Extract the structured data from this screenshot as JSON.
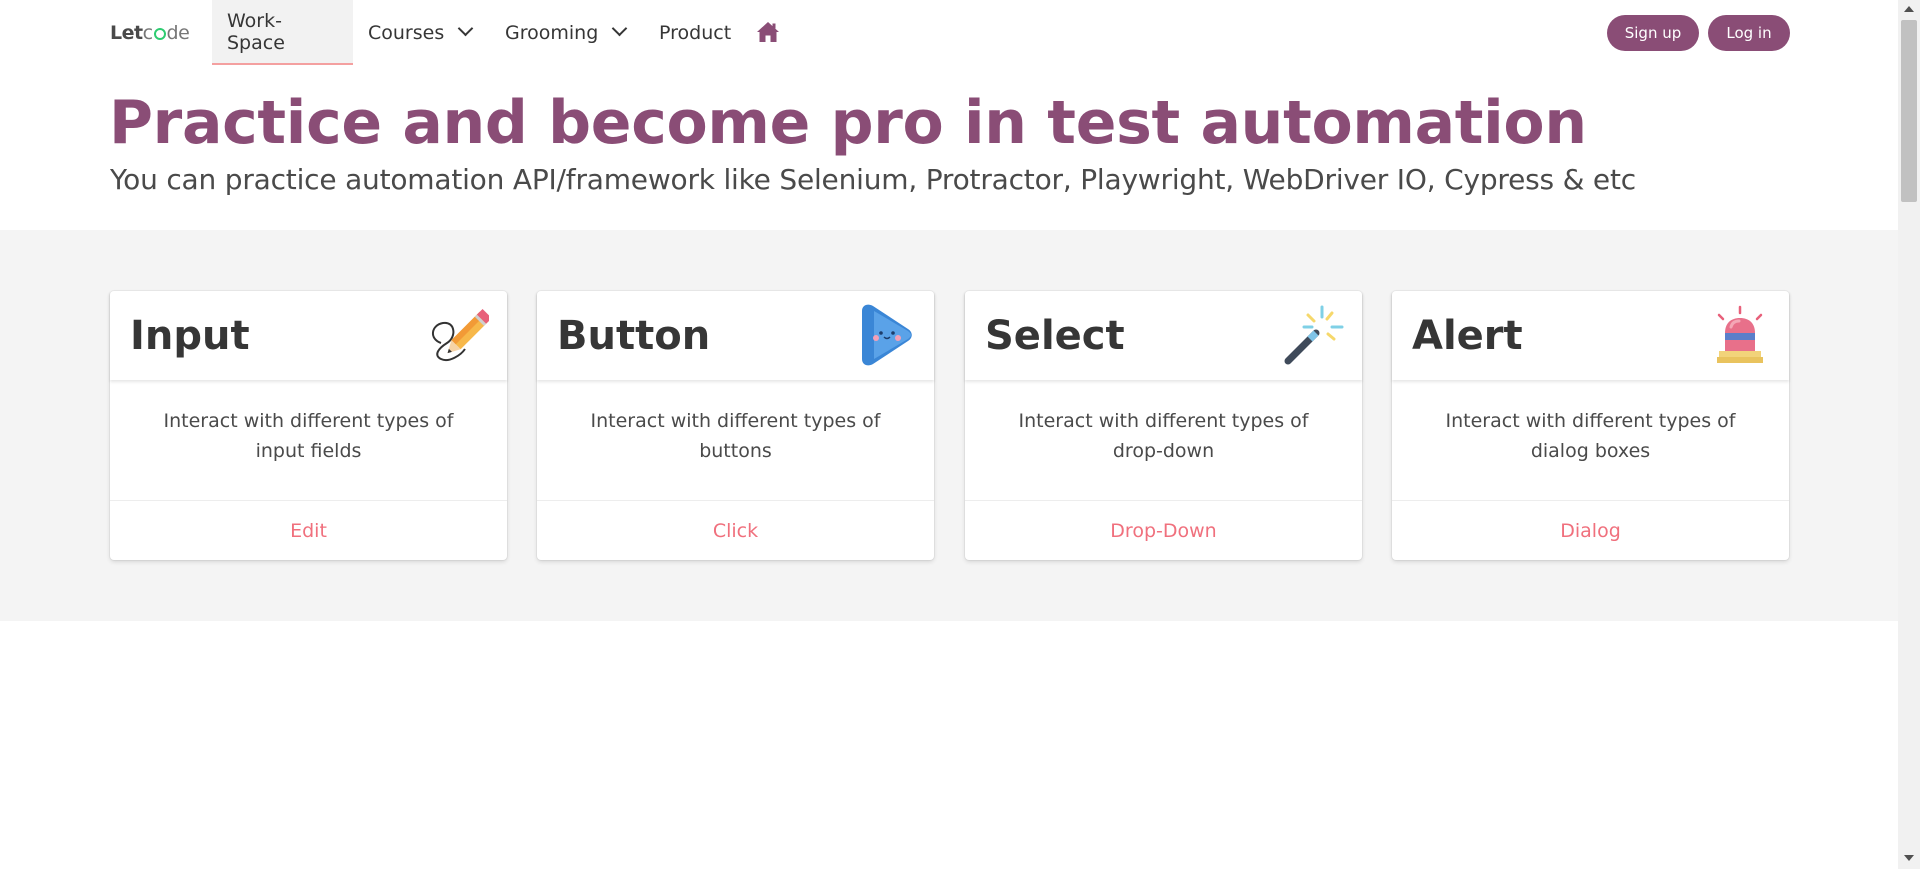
{
  "nav": {
    "logo": {
      "bold": "Let",
      "light_a": "c",
      "light_b": "de"
    },
    "items": [
      {
        "label": "Work-Space"
      },
      {
        "label": "Courses"
      },
      {
        "label": "Grooming"
      },
      {
        "label": "Product"
      }
    ],
    "home_icon": "home-icon",
    "signup": "Sign up",
    "login": "Log in"
  },
  "hero": {
    "title": "Practice and become pro in test automation",
    "subtitle": "You can practice automation API/framework like Selenium, Protractor, Playwright, WebDriver IO, Cypress & etc"
  },
  "cards": [
    {
      "title": "Input",
      "icon": "pencil-icon",
      "text": "Interact with different types of input fields",
      "link": "Edit"
    },
    {
      "title": "Button",
      "icon": "play-button-icon",
      "text": "Interact with different types of buttons",
      "link": "Click"
    },
    {
      "title": "Select",
      "icon": "magic-wand-icon",
      "text": "Interact with different types of drop-down",
      "link": "Drop-Down"
    },
    {
      "title": "Alert",
      "icon": "siren-icon",
      "text": "Interact with different types of dialog boxes",
      "link": "Dialog"
    }
  ],
  "colors": {
    "brand": "#8a4d76",
    "link": "#f0707d",
    "band": "#f4f4f4",
    "logo_ring": "#2ecc71"
  }
}
